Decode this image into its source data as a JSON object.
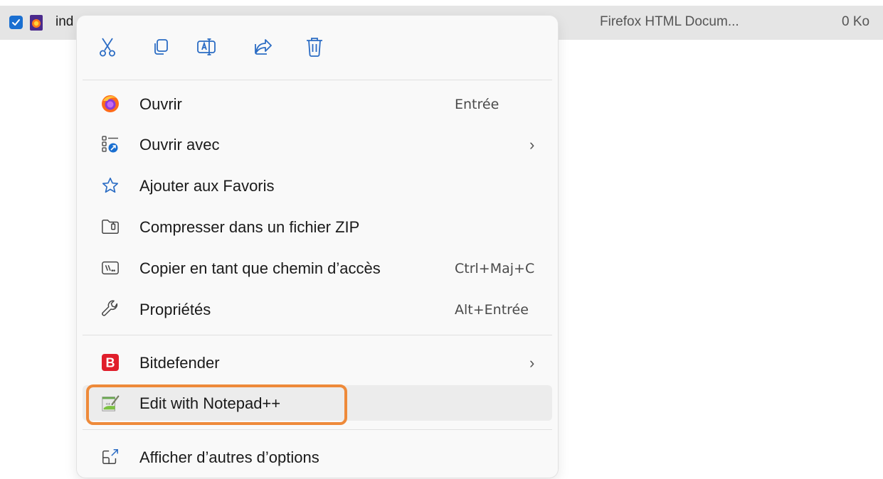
{
  "file_row": {
    "name": "ind",
    "type": "Firefox HTML Docum...",
    "size": "0 Ko"
  },
  "toolbar": {
    "buttons": [
      {
        "name": "cut",
        "icon": "scissors-icon"
      },
      {
        "name": "copy",
        "icon": "copy-icon"
      },
      {
        "name": "rename",
        "icon": "rename-icon"
      },
      {
        "name": "share",
        "icon": "share-icon"
      },
      {
        "name": "delete",
        "icon": "trash-icon"
      }
    ]
  },
  "menu": {
    "open": {
      "label": "Ouvrir",
      "shortcut": "Entrée",
      "icon": "firefox-icon"
    },
    "open_with": {
      "label": "Ouvrir avec",
      "icon": "open-with-icon"
    },
    "add_favorites": {
      "label": "Ajouter aux Favoris",
      "icon": "star-icon"
    },
    "compress_zip": {
      "label": "Compresser dans un fichier ZIP",
      "icon": "zip-folder-icon"
    },
    "copy_path": {
      "label": "Copier en tant que chemin d’accès",
      "shortcut": "Ctrl+Maj+C",
      "icon": "path-icon"
    },
    "properties": {
      "label": "Propriétés",
      "shortcut": "Alt+Entrée",
      "icon": "wrench-icon"
    },
    "bitdefender": {
      "label": "Bitdefender",
      "icon": "bitdefender-icon"
    },
    "notepadpp": {
      "label": "Edit with Notepad++",
      "icon": "notepadpp-icon"
    },
    "more_options": {
      "label": "Afficher d’autres d’options",
      "icon": "more-options-icon"
    }
  },
  "colors": {
    "accent": "#1a6fd1",
    "highlight": "#ee8a3a",
    "bitdefender": "#e01e2b"
  }
}
